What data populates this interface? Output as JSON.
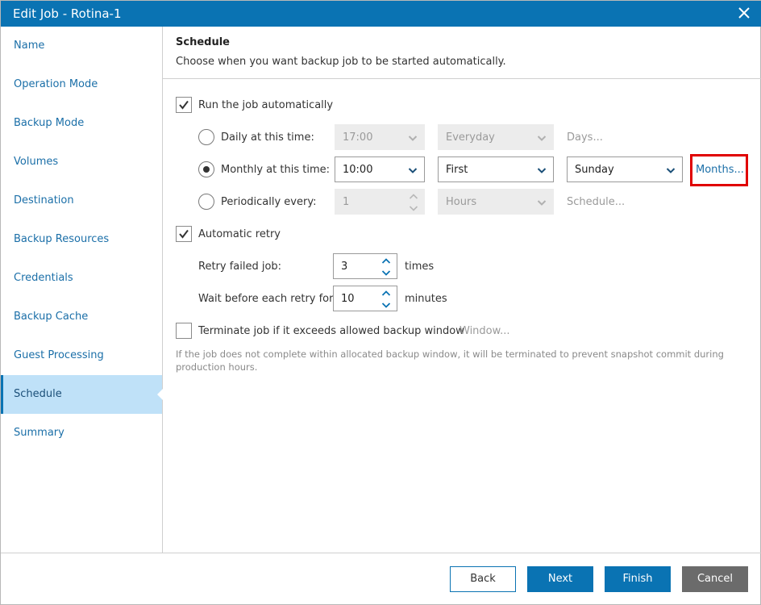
{
  "window": {
    "title": "Edit Job - Rotina-1"
  },
  "sidebar": {
    "items": [
      {
        "label": "Name"
      },
      {
        "label": "Operation Mode"
      },
      {
        "label": "Backup Mode"
      },
      {
        "label": "Volumes"
      },
      {
        "label": "Destination"
      },
      {
        "label": "Backup Resources"
      },
      {
        "label": "Credentials"
      },
      {
        "label": "Backup Cache"
      },
      {
        "label": "Guest Processing"
      },
      {
        "label": "Schedule"
      },
      {
        "label": "Summary"
      }
    ],
    "active": "Schedule"
  },
  "header": {
    "title": "Schedule",
    "subtitle": "Choose when you want backup job to be started automatically."
  },
  "schedule": {
    "run_automatically": {
      "label": "Run the job automatically",
      "checked": true
    },
    "daily": {
      "label": "Daily at this time:",
      "time": "17:00",
      "frequency": "Everyday",
      "link": "Days..."
    },
    "monthly": {
      "label": "Monthly at this time:",
      "time": "10:00",
      "occurrence": "First",
      "weekday": "Sunday",
      "link": "Months..."
    },
    "periodically": {
      "label": "Periodically every:",
      "value": "1",
      "unit": "Hours",
      "link": "Schedule..."
    },
    "selected_mode": "monthly"
  },
  "retry": {
    "automatic_retry": {
      "label": "Automatic retry",
      "checked": true
    },
    "retry_failed": {
      "label": "Retry failed job:",
      "value": "3",
      "unit": "times"
    },
    "wait_before": {
      "label": "Wait before each retry for:",
      "value": "10",
      "unit": "minutes"
    }
  },
  "window_option": {
    "terminate": {
      "label": "Terminate job if it exceeds allowed backup window",
      "checked": false
    },
    "link": "Window...",
    "note": "If the job does not complete within allocated backup window, it will be terminated to prevent snapshot commit during production hours."
  },
  "buttons": {
    "back": "Back",
    "next": "Next",
    "finish": "Finish",
    "cancel": "Cancel"
  },
  "colors": {
    "titlebar": "#0a73b3",
    "active_nav": "#bfe1f8",
    "link": "#1b6fa8",
    "highlight": "#e00000",
    "cancel_button": "#6b6b6b"
  }
}
